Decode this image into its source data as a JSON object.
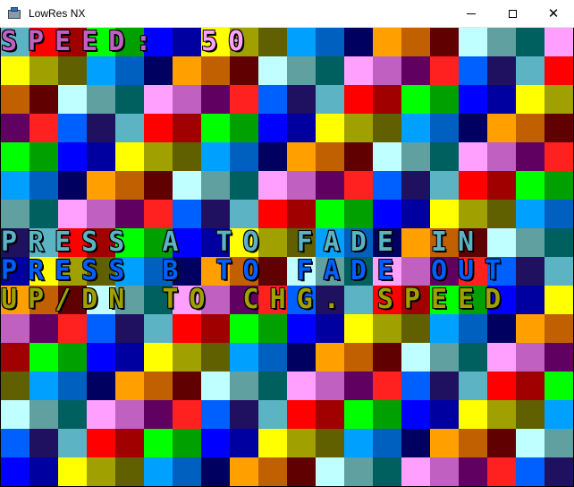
{
  "window": {
    "title": "LowRes NX",
    "icon": "lowres-nx-app-icon",
    "buttons": {
      "minimize": "minimize-icon",
      "maximize": "maximize-icon",
      "close": "close-icon"
    }
  },
  "game": {
    "palette": [
      "#5bb3c4",
      "#ff0000",
      "#a00000",
      "#00ff00",
      "#00a000",
      "#0000ff",
      "#0000a0",
      "#ffff00",
      "#a0a000",
      "#606000",
      "#00a0ff",
      "#0060c0",
      "#000060",
      "#ffa000",
      "#c06000",
      "#600000",
      "#c0ffff",
      "#60a0a0",
      "#006060",
      "#ffa0ff",
      "#c060c0",
      "#600060",
      "#ff2020",
      "#0060ff",
      "#201060"
    ],
    "speed_line": {
      "label": "SPEED:",
      "value": "50"
    },
    "instructions": [
      "PRESS A TO FADE IN",
      "PRESS B TO FADE OUT",
      "UP/DN TO CHG. SPEED"
    ],
    "text_colors": {
      "speed": "#c060c0",
      "speed_value": "#ffa0ff",
      "line1": "#5bb3c4",
      "line2": "#0060ff",
      "line3": "#a0a000"
    }
  }
}
